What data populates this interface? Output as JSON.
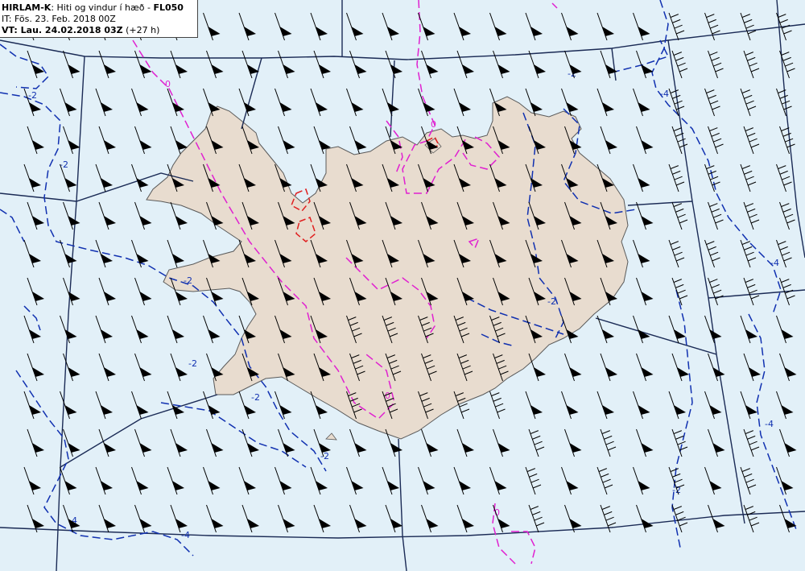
{
  "header": {
    "model": "HIRLAM-K",
    "sep1": ": ",
    "description": "Hiti og vindur í hæð",
    "sep2": " - ",
    "level": "FL050",
    "it_label": "IT: ",
    "it_value": "Fös. 23. Feb. 2018 00Z",
    "vt_label": "VT: ",
    "vt_value": "Lau. 24.02.2018 03Z",
    "vt_offset": " (+27 h)"
  },
  "contour_labels": [
    "0",
    "-2",
    "-4"
  ],
  "colors": {
    "sea": "#e2f0f8",
    "land": "#e8dccf",
    "coast": "#5a5a5a",
    "frame": "#1a2a55",
    "isotherm_zero": "#e020d0",
    "isotherm_negative": "#1030b0",
    "isotherm_positive": "#e02020",
    "wind_barb": "#000000"
  },
  "wind": {
    "direction_from": "NNW",
    "barbs": "triangular flag pennants, denser hatched barbs over eastern land and sea"
  }
}
